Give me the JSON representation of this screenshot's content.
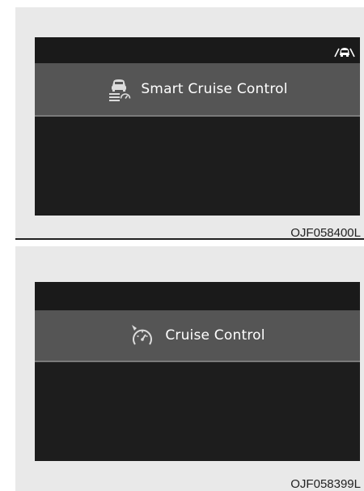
{
  "panels": [
    {
      "title": "Smart Cruise Control",
      "icon": "smart-cruise-control-icon",
      "status_icon": "vehicle-ahead-icon",
      "code": "OJF058400L"
    },
    {
      "title": "Cruise Control",
      "icon": "cruise-control-icon",
      "code": "OJF058399L"
    }
  ],
  "colors": {
    "panel_background": "#e9e9e9",
    "screen": "#1d1d1d",
    "title_band": "#555555",
    "text": "#ffffff"
  }
}
